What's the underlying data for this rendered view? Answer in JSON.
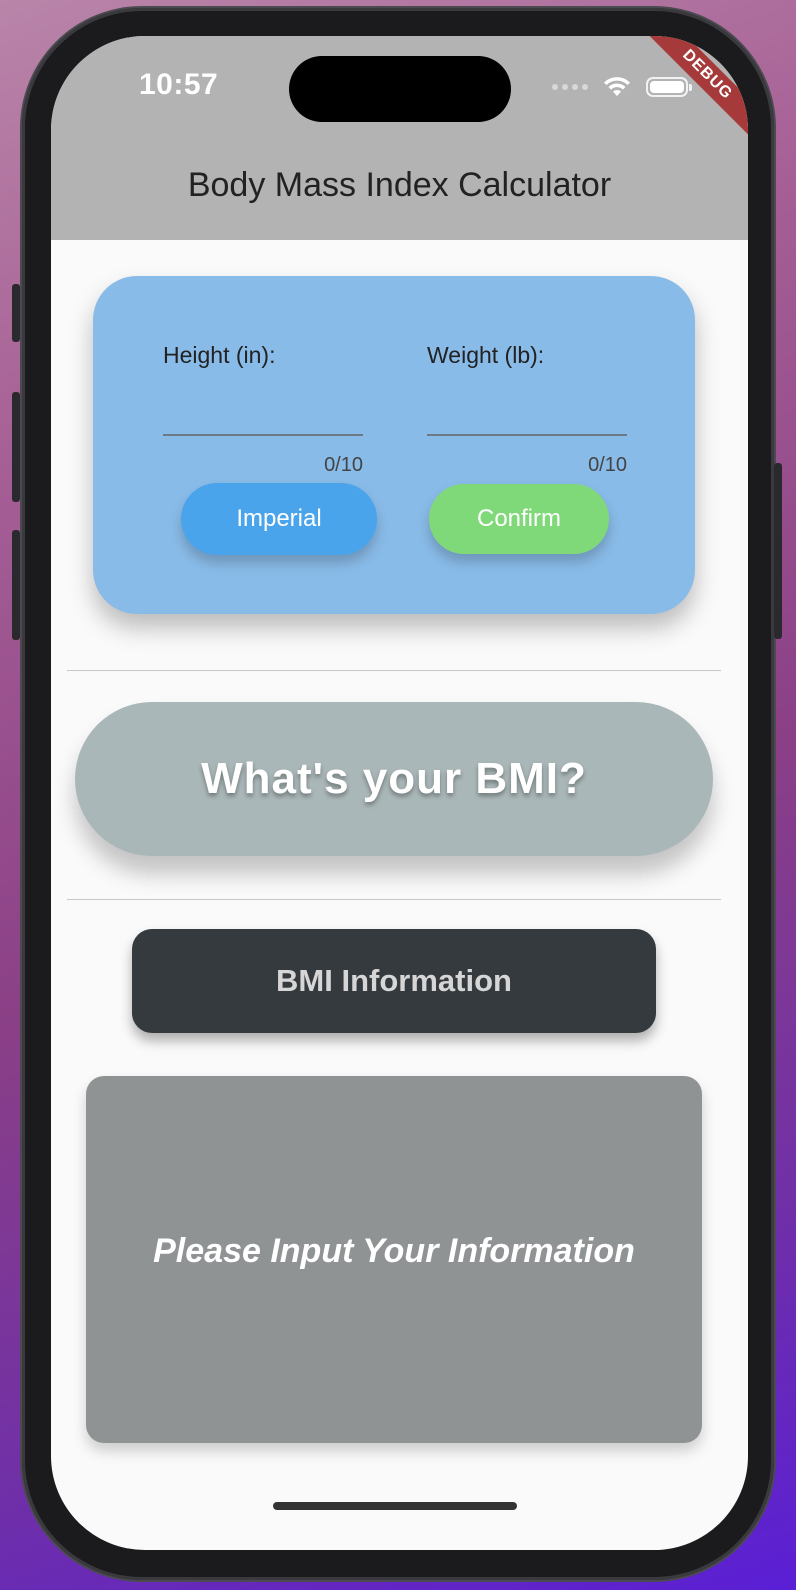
{
  "status_bar": {
    "time": "10:57",
    "banner": "DEBUG"
  },
  "appbar": {
    "title": "Body Mass Index Calculator"
  },
  "form": {
    "height_label": "Height (in):",
    "height_value": "",
    "height_counter": "0/10",
    "weight_label": "Weight (lb):",
    "weight_value": "",
    "weight_counter": "0/10",
    "unit_button": "Imperial",
    "confirm_button": "Confirm"
  },
  "result": {
    "headline": "What's your BMI?"
  },
  "info": {
    "button_label": "BMI Information",
    "message": "Please Input Your Information"
  },
  "icons": [
    "wifi-icon",
    "battery-icon",
    "cellular-signal-icon"
  ],
  "colors": {
    "appbar": "#b3b3b3",
    "card": "#89bbe8",
    "imperial_button": "#4aa4ec",
    "confirm_button": "#80d979",
    "bmi_pill": "#aab7b8",
    "info_button": "#343a3e",
    "info_card": "#8f9394",
    "debug_banner": "#a63a3a"
  }
}
